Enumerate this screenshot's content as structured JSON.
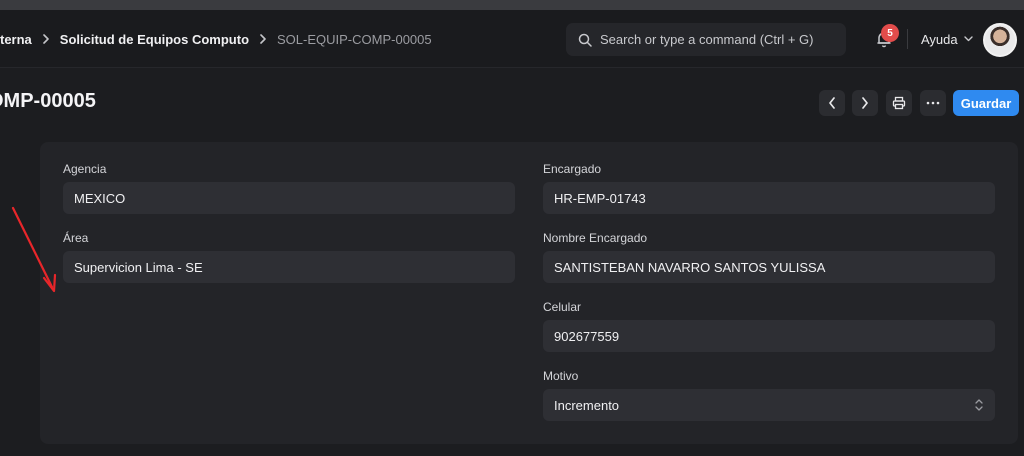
{
  "breadcrumb": {
    "items": [
      "terna",
      "Solicitud de Equipos Computo"
    ],
    "current": "SOL-EQUIP-COMP-00005"
  },
  "search": {
    "placeholder": "Search or type a command (Ctrl + G)"
  },
  "notifications": {
    "count": "5"
  },
  "help": {
    "label": "Ayuda"
  },
  "page": {
    "title": "OMP-00005"
  },
  "toolbar": {
    "save_label": "Guardar"
  },
  "form": {
    "agencia": {
      "label": "Agencia",
      "value": "MEXICO"
    },
    "area": {
      "label": "Área",
      "value": "Supervicion Lima - SE"
    },
    "encargado": {
      "label": "Encargado",
      "value": "HR-EMP-01743"
    },
    "nombre_encargado": {
      "label": "Nombre Encargado",
      "value": "SANTISTEBAN NAVARRO SANTOS YULISSA"
    },
    "celular": {
      "label": "Celular",
      "value": "902677559"
    },
    "motivo": {
      "label": "Motivo",
      "value": "Incremento"
    }
  },
  "colors": {
    "accent": "#2f8af0",
    "badge": "#e24c4b",
    "annotation_arrow": "#e8262a"
  }
}
